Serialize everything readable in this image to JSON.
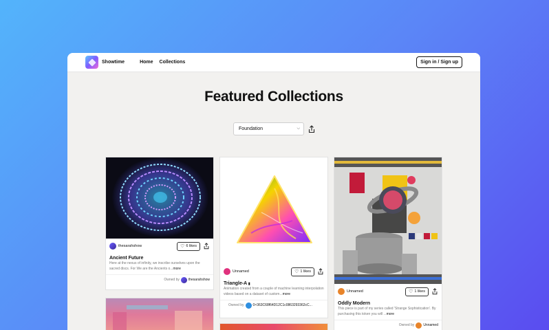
{
  "nav": {
    "brand": "Showtime",
    "links": [
      "Home",
      "Collections"
    ],
    "signin": "Sign in / Sign up"
  },
  "heading": "Featured Collections",
  "filter": {
    "selected": "Foundation"
  },
  "cards": [
    {
      "owner": "thesarahshow",
      "likes": "6 likes",
      "title": "Ancient Future",
      "desc": "Here at the nexus of infinity, we inscribe ourselves upon the sacred discs. For We are the Ancients o...",
      "more": "more",
      "owned_label": "Owned by",
      "owned_by": "thesarahshow"
    },
    {
      "owner": "Unnamed",
      "likes": "1 likes",
      "title": "Triangle-A",
      "desc": "Animation created from a couple of machine learning interpolation videos based on a dataset of custom...",
      "more": "more",
      "owned_label": "Owned by",
      "owned_by": "0×363C68f64D12C1c0863293362cC..."
    },
    {
      "owner": "Unnamed",
      "likes": "1 likes",
      "title": "Oddly Modern",
      "desc": "This piece is part of my series called 'Strange Sophistication'. By purchasing this token you will ...",
      "more": "more",
      "owned_label": "Owned by",
      "owned_by": "Unnamed"
    }
  ],
  "colors": {
    "bg_gradient_start": "#53b4fb",
    "bg_gradient_end": "#5a4cf0",
    "page_bg": "#f2f1ef"
  }
}
